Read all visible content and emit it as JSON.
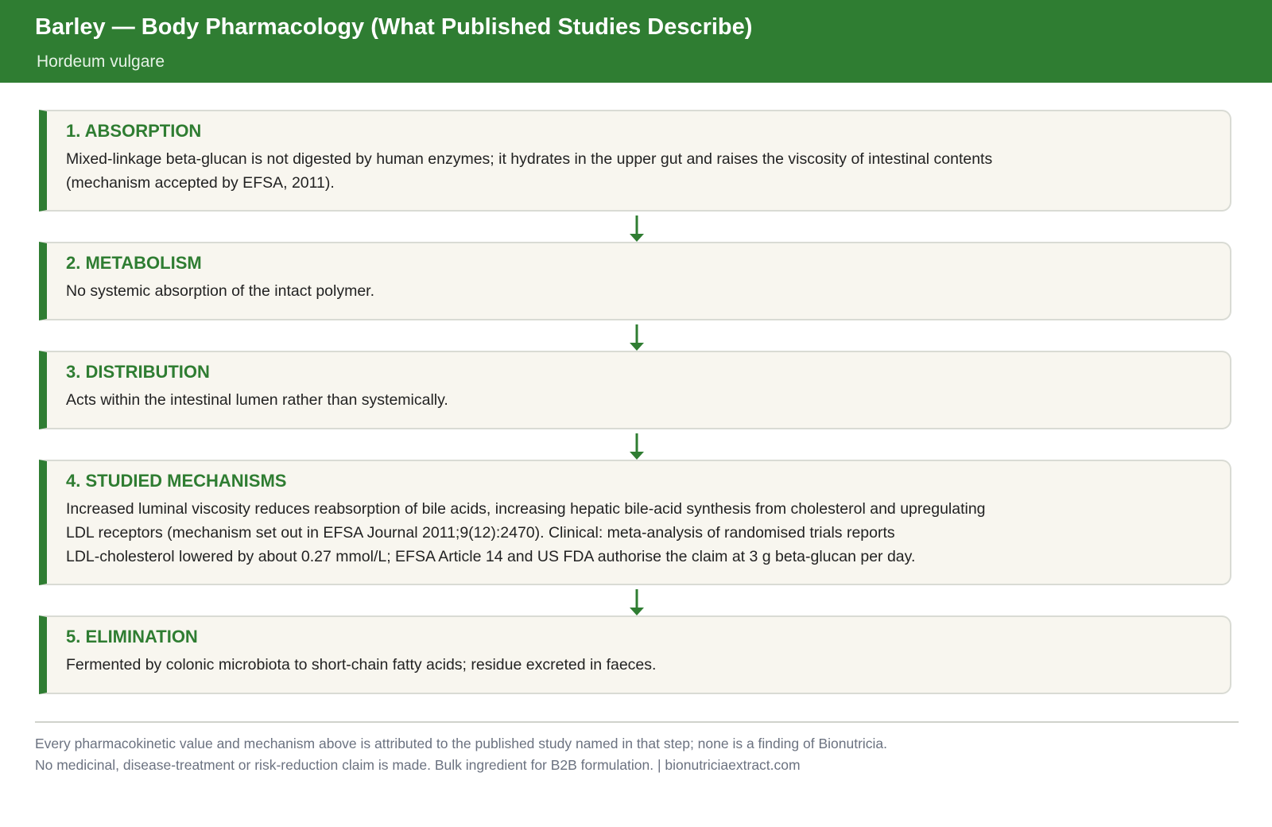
{
  "header": {
    "title": "Barley — Body Pharmacology (What Published Studies Describe)",
    "subtitle": "Hordeum vulgare"
  },
  "steps": [
    {
      "title": "1. ABSORPTION",
      "lines": [
        "Mixed-linkage beta-glucan is not digested by human enzymes; it hydrates in the upper gut and raises the viscosity of intestinal contents",
        "(mechanism accepted by EFSA, 2011)."
      ]
    },
    {
      "title": "2. METABOLISM",
      "lines": [
        "No systemic absorption of the intact polymer."
      ]
    },
    {
      "title": "3. DISTRIBUTION",
      "lines": [
        "Acts within the intestinal lumen rather than systemically."
      ]
    },
    {
      "title": "4. STUDIED MECHANISMS",
      "lines": [
        "Increased luminal viscosity reduces reabsorption of bile acids, increasing hepatic bile-acid synthesis from cholesterol and upregulating",
        "LDL receptors (mechanism set out in EFSA Journal 2011;9(12):2470). Clinical: meta-analysis of randomised trials reports",
        "LDL-cholesterol lowered by about 0.27 mmol/L; EFSA Article 14 and US FDA authorise the claim at 3 g beta-glucan per day."
      ]
    },
    {
      "title": "5. ELIMINATION",
      "lines": [
        "Fermented by colonic microbiota to short-chain fatty acids; residue excreted in faeces."
      ]
    }
  ],
  "footer": {
    "line1": "Every pharmacokinetic value and mechanism above is attributed to the published study named in that step; none is a finding of Bionutricia.",
    "line2": "No medicinal, disease-treatment or risk-reduction claim is made. Bulk ingredient for B2B formulation.  |  bionutriciaextract.com"
  },
  "colors": {
    "accent": "#2f7d32",
    "card_background": "#f8f6ef",
    "footer_text": "#6b7280"
  },
  "icons": {
    "connector": "arrow-down-icon"
  }
}
